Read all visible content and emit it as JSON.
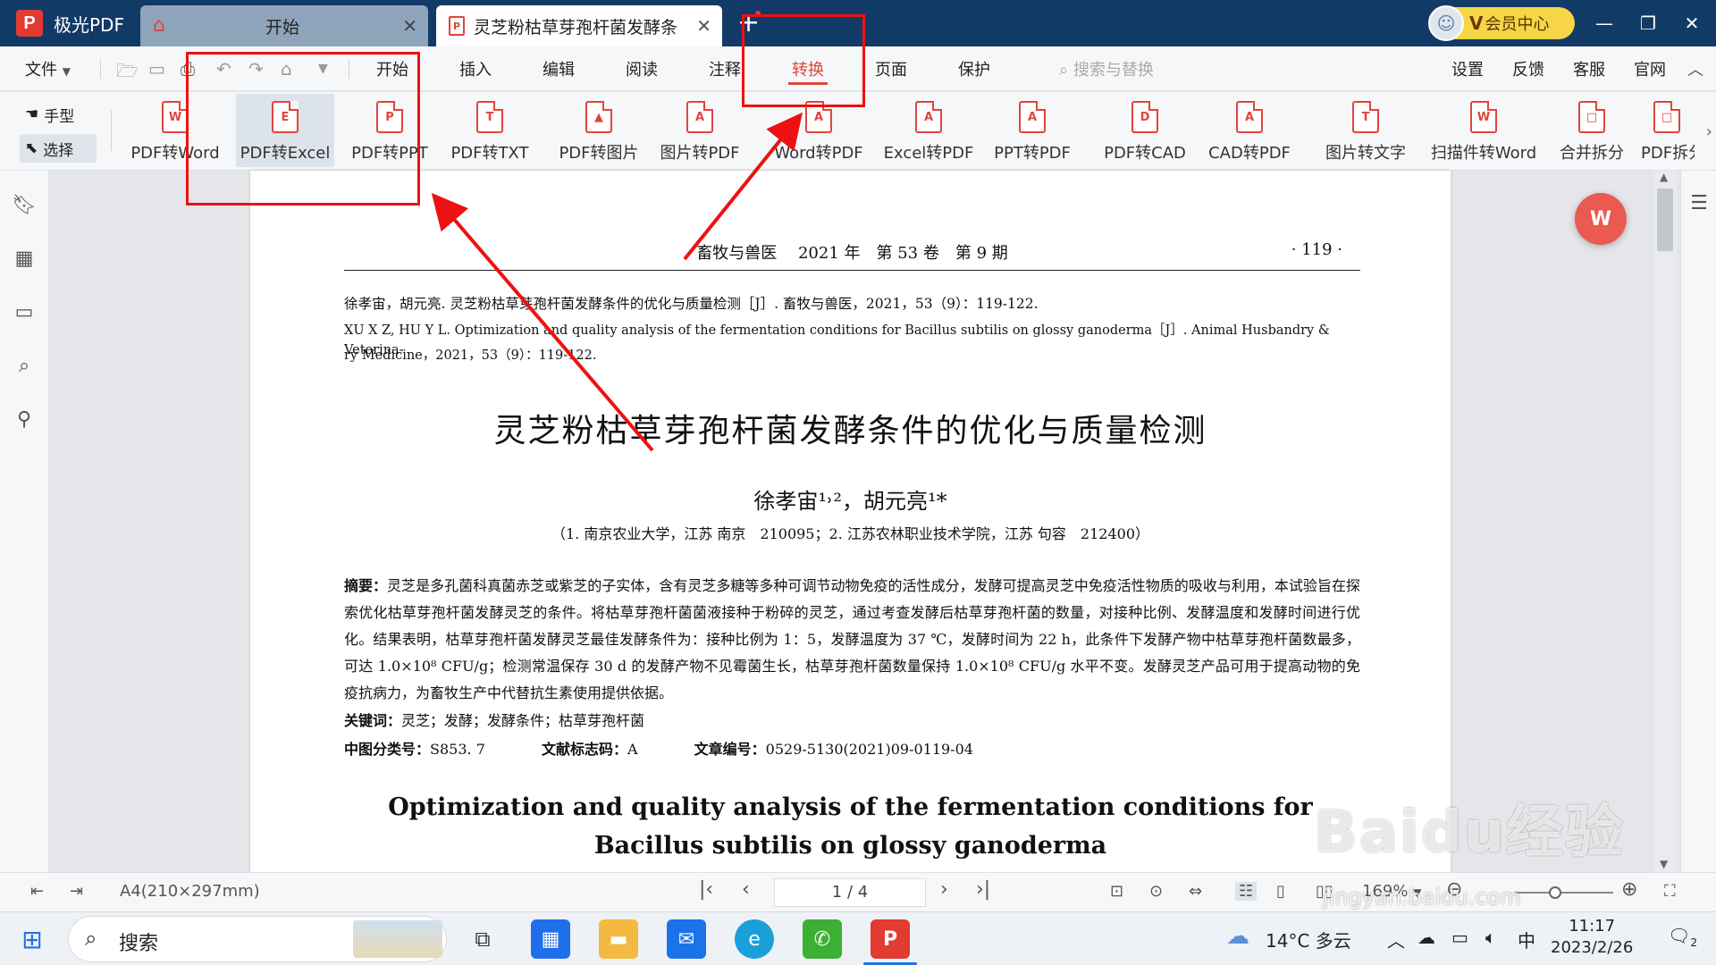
{
  "app": {
    "name": "极光PDF",
    "logo_letter": "P"
  },
  "tabs": [
    {
      "label": "开始"
    },
    {
      "label": "灵芝粉枯草芽孢杆菌发酵条..."
    }
  ],
  "member": {
    "label": "会员中心",
    "vip": "V"
  },
  "window": {
    "minimize": "—",
    "restore": "❐",
    "close": "✕"
  },
  "menu": {
    "file": "文件",
    "items": [
      "开始",
      "插入",
      "编辑",
      "阅读",
      "注释",
      "转换",
      "页面",
      "保护"
    ],
    "search_placeholder": "搜索与替换",
    "right": [
      "设置",
      "反馈",
      "客服",
      "官网"
    ]
  },
  "modes": {
    "hand": "手型",
    "select": "选择"
  },
  "tools": [
    {
      "label": "PDF转Word",
      "glyph": "W"
    },
    {
      "label": "PDF转Excel",
      "glyph": "E"
    },
    {
      "label": "PDF转PPT",
      "glyph": "P"
    },
    {
      "label": "PDF转TXT",
      "glyph": "T"
    },
    {
      "label": "PDF转图片",
      "glyph": "▲"
    },
    {
      "label": "图片转PDF",
      "glyph": "A"
    },
    {
      "label": "Word转PDF",
      "glyph": "A"
    },
    {
      "label": "Excel转PDF",
      "glyph": "A"
    },
    {
      "label": "PPT转PDF",
      "glyph": "A"
    },
    {
      "label": "PDF转CAD",
      "glyph": "D"
    },
    {
      "label": "CAD转PDF",
      "glyph": "A"
    },
    {
      "label": "图片转文字",
      "glyph": "T"
    },
    {
      "label": "扫描件转Word",
      "glyph": "W"
    },
    {
      "label": "合并拆分",
      "glyph": "□"
    },
    {
      "label": "PDF拆分",
      "glyph": "□"
    }
  ],
  "document": {
    "journal": "畜牧与兽医　 2021 年　第 53 卷　第 9 期",
    "page_number": "· 119 ·",
    "cite_cn": "徐孝宙，胡元亮. 灵芝粉枯草芽孢杆菌发酵条件的优化与质量检测［J］. 畜牧与兽医，2021，53（9）：119-122.",
    "cite_en_1": "XU X Z, HU Y L. Optimization and quality analysis of the fermentation conditions for Bacillus subtilis on glossy ganoderma［J］. Animal Husbandry & Veterina-",
    "cite_en_2": "ry Medicine，2021，53（9）：119-122.",
    "title": "灵芝粉枯草芽孢杆菌发酵条件的优化与质量检测",
    "authors": "徐孝宙¹˒²，胡元亮¹*",
    "affiliation": "（1. 南京农业大学，江苏 南京　210095；2. 江苏农林职业技术学院，江苏 句容　212400）",
    "abstract_label": "摘要：",
    "abstract_text": "灵芝是多孔菌科真菌赤芝或紫芝的子实体，含有灵芝多糖等多种可调节动物免疫的活性成分，发酵可提高灵芝中免疫活性物质的吸收与利用，本试验旨在探索优化枯草芽孢杆菌发酵灵芝的条件。将枯草芽孢杆菌菌液接种于粉碎的灵芝，通过考查发酵后枯草芽孢杆菌的数量，对接种比例、发酵温度和发酵时间进行优化。结果表明，枯草芽孢杆菌发酵灵芝最佳发酵条件为：接种比例为 1：5，发酵温度为 37 ℃，发酵时间为 22 h，此条件下发酵产物中枯草芽孢杆菌数最多，可达 1.0×10⁸ CFU/g；检测常温保存 30 d 的发酵产物不见霉菌生长，枯草芽孢杆菌数量保持 1.0×10⁸ CFU/g 水平不变。发酵灵芝产品可用于提高动物的免疫抗病力，为畜牧生产中代替抗生素使用提供依据。",
    "keywords_label": "关键词：",
    "keywords": "灵芝；发酵；发酵条件；枯草芽孢杆菌",
    "clc_label": "中图分类号：",
    "clc": "S853. 7",
    "doccode_label": "文献标志码：",
    "doccode": "A",
    "article_label": "文章编号：",
    "article": "0529-5130(2021)09-0119-04",
    "en_title_1": "Optimization and quality analysis of the fermentation conditions for",
    "en_title_2": "Bacillus subtilis on glossy ganoderma"
  },
  "status": {
    "paper_size": "A4(210×297mm)",
    "page": "1 / 4",
    "zoom": "169%"
  },
  "taskbar": {
    "search": "搜索",
    "weather": "14°C 多云",
    "ime": "中",
    "time": "11:17",
    "date": "2023/2/26",
    "notifications": "2"
  },
  "watermark": {
    "brand": "Baidu经验",
    "url": "jingyan.baidu.com"
  },
  "colors": {
    "titlebar": "#123a66",
    "accent": "#e0453b",
    "annotation": "#ee1111"
  }
}
